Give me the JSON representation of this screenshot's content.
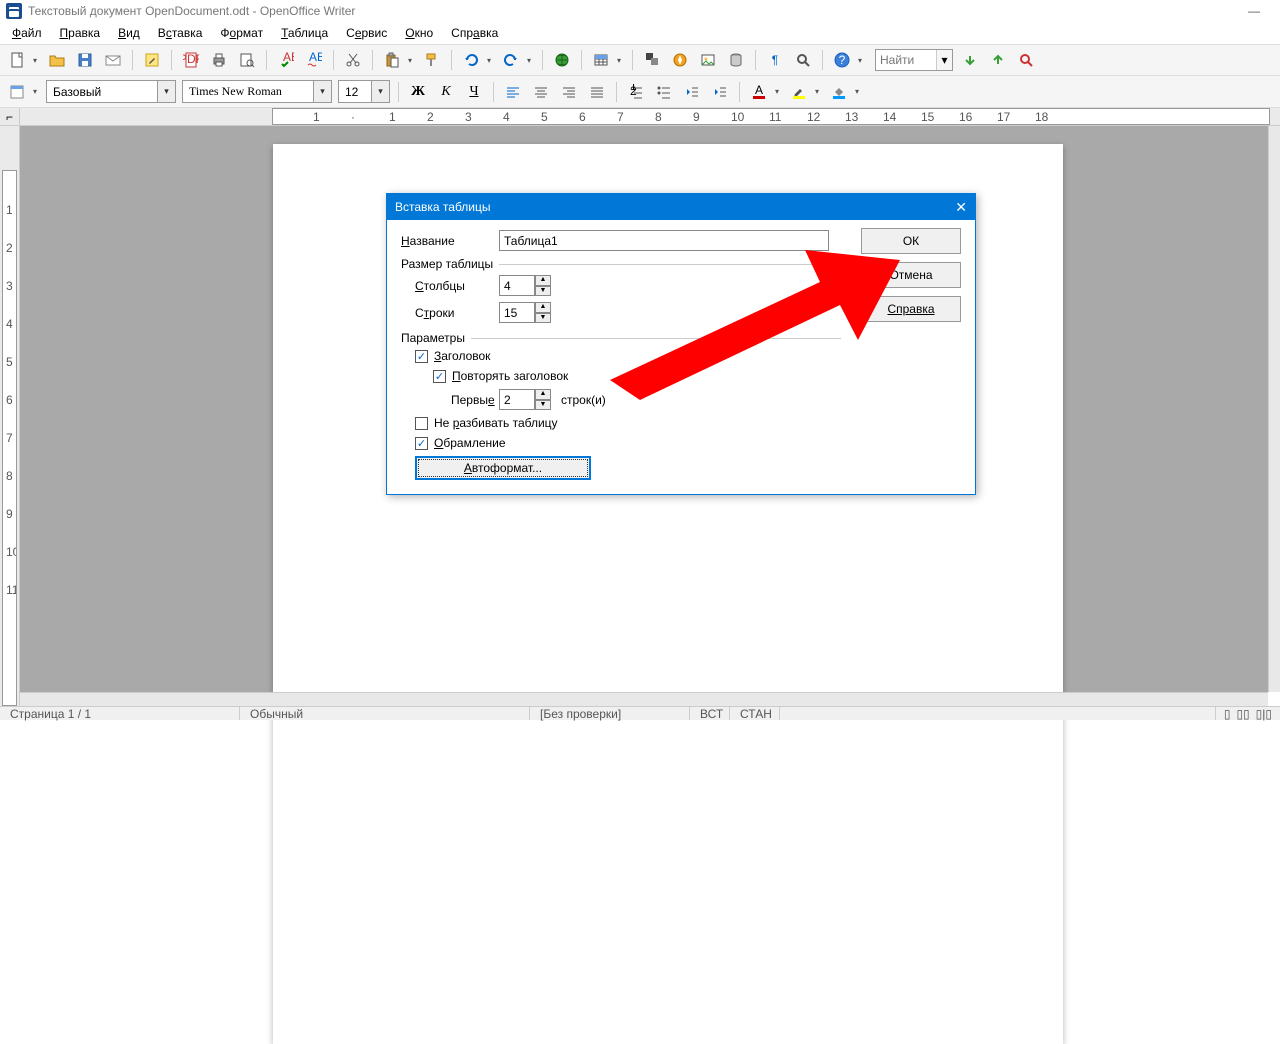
{
  "window": {
    "title": "Текстовый документ OpenDocument.odt - OpenOffice Writer"
  },
  "menu": [
    "Файл",
    "Правка",
    "Вид",
    "Вставка",
    "Формат",
    "Таблица",
    "Сервис",
    "Окно",
    "Справка"
  ],
  "menu_u": [
    0,
    0,
    0,
    0,
    1,
    0,
    0,
    0,
    2
  ],
  "format": {
    "style": "Базовый",
    "font": "Times New Roman",
    "size": "12"
  },
  "search": {
    "placeholder": "Найти"
  },
  "dialog": {
    "title": "Вставка таблицы",
    "name_label": "Название",
    "name_value": "Таблица1",
    "size_label": "Размер таблицы",
    "cols_label": "Столбцы",
    "cols_value": "4",
    "rows_label": "Строки",
    "rows_value": "15",
    "params_label": "Параметры",
    "header_label": "Заголовок",
    "repeat_label": "Повторять заголовок",
    "first_label": "Первые",
    "first_value": "2",
    "rows_unit": "строк(и)",
    "nosplit_label": "Не разбивать таблицу",
    "border_label": "Обрамление",
    "autofmt_label": "Автоформат...",
    "ok": "ОК",
    "cancel": "Отмена",
    "help": "Справка"
  },
  "status": {
    "page": "Страница  1 / 1",
    "style": "Обычный",
    "lang": "[Без проверки]",
    "ins": "ВСТ",
    "std": "СТАН"
  }
}
